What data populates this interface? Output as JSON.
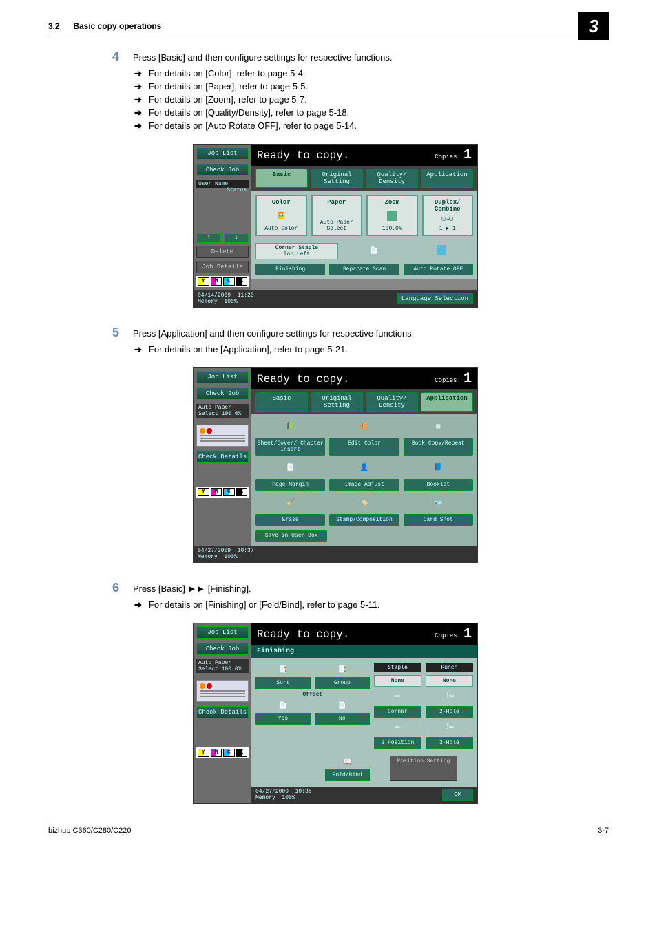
{
  "header": {
    "section_num": "3.2",
    "section_title": "Basic copy operations",
    "chapter": "3"
  },
  "steps": [
    {
      "num": "4",
      "text": "Press [Basic] and then configure settings for respective functions.",
      "subs": [
        "For details on [Color], refer to page 5-4.",
        "For details on [Paper], refer to page 5-5.",
        "For details on [Zoom], refer to page 5-7.",
        "For details on [Quality/Density], refer to page 5-18.",
        "For details on [Auto Rotate OFF], refer to page 5-14."
      ]
    },
    {
      "num": "5",
      "text": "Press [Application] and then configure settings for respective functions.",
      "subs": [
        "For details on the [Application], refer to page 5-21."
      ]
    },
    {
      "num": "6",
      "text": "Press [Basic] ►► [Finishing].",
      "subs": [
        "For details on [Finishing] or [Fold/Bind], refer to page 5-11."
      ]
    }
  ],
  "panel_common": {
    "ready": "Ready to copy.",
    "copies_label": "Copies:",
    "copies_value": "1",
    "job_list": "Job List",
    "check_job": "Check Job",
    "check_details": "Check Details",
    "user_name": "User Name",
    "status": "Status",
    "delete": "Delete",
    "job_details": "Job Details",
    "auto_paper": "Auto Paper Select",
    "hundred": "100.0%",
    "toner": {
      "y": "Y",
      "m": "M",
      "c": "C",
      "k": "K"
    },
    "lang": "Language Selection",
    "memory": "Memory",
    "mempct": "100%"
  },
  "panel1": {
    "date": "04/14/2009",
    "time": "11:20",
    "tabs": [
      "Basic",
      "Original Setting",
      "Quality/ Density",
      "Application"
    ],
    "big": [
      {
        "title": "Color",
        "val": "Auto Color"
      },
      {
        "title": "Paper",
        "val": "Auto Paper Select"
      },
      {
        "title": "Zoom",
        "val": "100.0%"
      },
      {
        "title": "Duplex/ Combine",
        "val": "1 ▶ 1"
      }
    ],
    "mid": {
      "cs": "Corner Staple",
      "tl": "Top Left"
    },
    "bottoms": [
      "Finishing",
      "Separate Scan",
      "Auto Rotate OFF"
    ]
  },
  "panel2": {
    "date": "04/27/2009",
    "time": "10:37",
    "tabs": [
      "Basic",
      "Original Setting",
      "Quality/ Density",
      "Application"
    ],
    "rows": [
      [
        "Sheet/Cover/ Chapter Insert",
        "Edit Color",
        "Book Copy/Repeat"
      ],
      [
        "Page Margin",
        "Image Adjust",
        "Booklet"
      ],
      [
        "Erase",
        "Stamp/Composition",
        "Card Shot"
      ]
    ],
    "save": "Save in User Box"
  },
  "panel3": {
    "date": "04/27/2009",
    "time": "10:38",
    "title": "Finishing",
    "sort": "Sort",
    "group": "Group",
    "offset": "Offset",
    "yes": "Yes",
    "no": "No",
    "foldbind": "Fold/Bind",
    "staple": "Staple",
    "punch": "Punch",
    "none": "None",
    "corner": "Corner",
    "two_hole": "2-Hole",
    "two_pos": "2 Position",
    "three_hole": "3-Hole",
    "pos_setting": "Position Setting",
    "ok": "OK"
  },
  "footer": {
    "model": "bizhub C360/C280/C220",
    "page": "3-7"
  }
}
